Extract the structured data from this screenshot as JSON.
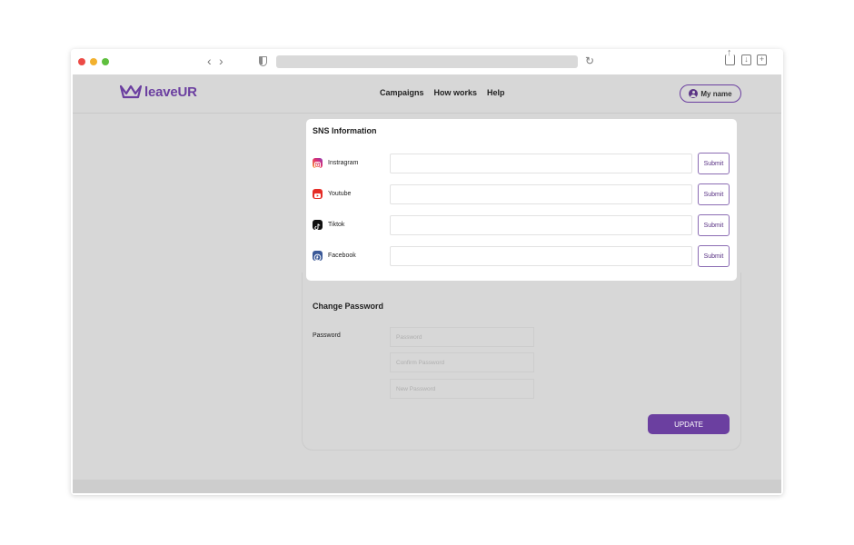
{
  "browser": {
    "url": ""
  },
  "brand": {
    "name": "leaveUR",
    "color": "#6b3fa0"
  },
  "nav": {
    "items": [
      "Campaigns",
      "How works",
      "Help"
    ]
  },
  "user": {
    "label": "My name"
  },
  "sns": {
    "title": "SNS Information",
    "rows": [
      {
        "platform": "Instragram",
        "icon": "instagram-icon",
        "submit_label": "Submit"
      },
      {
        "platform": "Youtube",
        "icon": "youtube-icon",
        "submit_label": "Submit"
      },
      {
        "platform": "Tiktok",
        "icon": "tiktok-icon",
        "submit_label": "Submit"
      },
      {
        "platform": "Facebook",
        "icon": "facebook-icon",
        "submit_label": "Submit"
      }
    ]
  },
  "password": {
    "title": "Change Password",
    "label": "Password",
    "fields": [
      {
        "placeholder": "Password"
      },
      {
        "placeholder": "Confirm Password"
      },
      {
        "placeholder": "New Password"
      }
    ],
    "update_label": "UPDATE"
  }
}
